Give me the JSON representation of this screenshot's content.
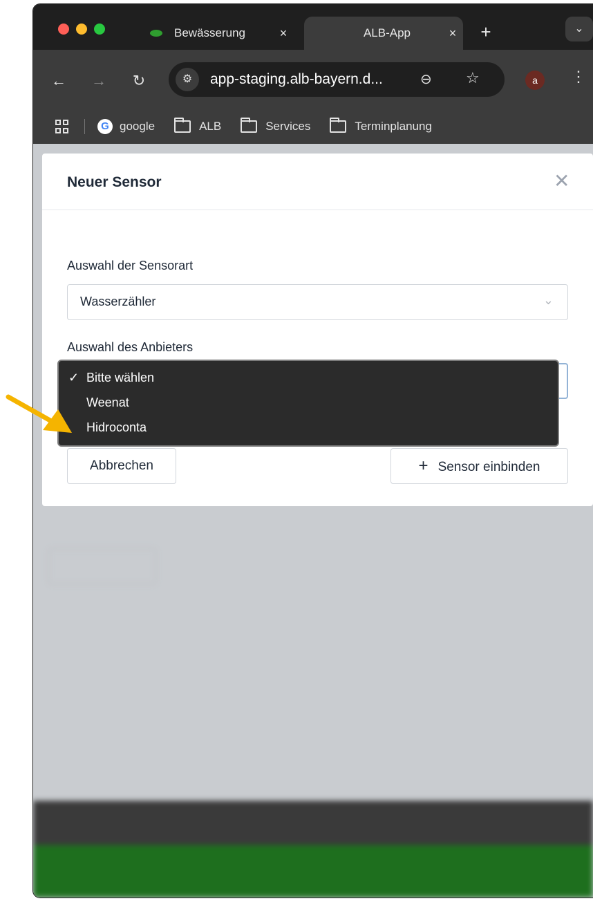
{
  "browser": {
    "tabs": [
      {
        "title": "Bewässerung",
        "close": "×"
      },
      {
        "title": "ALB-App",
        "close": "×"
      }
    ],
    "new_tab": "+",
    "url": "app-staging.alb-bayern.d...",
    "avatar_letter": "a",
    "bookmarks": [
      {
        "label": "google",
        "icon": "google-icon"
      },
      {
        "label": "ALB",
        "icon": "folder-icon"
      },
      {
        "label": "Services",
        "icon": "folder-icon"
      },
      {
        "label": "Terminplanung",
        "icon": "folder-icon"
      }
    ]
  },
  "modal": {
    "title": "Neuer Sensor",
    "sensor_type_label": "Auswahl der Sensorart",
    "sensor_type_value": "Wasserzähler",
    "provider_label": "Auswahl des Anbieters",
    "cancel_label": "Abbrechen",
    "submit_label": "Sensor einbinden"
  },
  "dropdown": {
    "options": [
      {
        "label": "Bitte wählen",
        "selected": true
      },
      {
        "label": "Weenat",
        "selected": false
      },
      {
        "label": "Hidroconta",
        "selected": false
      }
    ]
  },
  "colors": {
    "arrow": "#f5b400",
    "footer_green": "#1e6f1e"
  }
}
